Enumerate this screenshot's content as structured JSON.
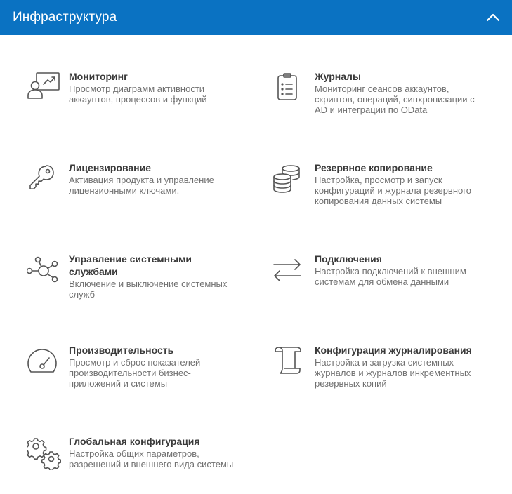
{
  "header": {
    "title": "Инфраструктура"
  },
  "tiles": [
    {
      "title": "Мониторинг",
      "description": "Просмотр диаграмм активности аккаунтов, процессов и функций",
      "icon": "monitoring-user-chart-icon"
    },
    {
      "title": "Журналы",
      "description": "Мониторинг сеансов аккаунтов, скриптов, операций, синхронизации с AD и интеграции по OData",
      "icon": "clipboard-list-icon"
    },
    {
      "title": "Лицензирование",
      "description": "Активация продукта и управление лицензионными ключами.",
      "icon": "key-icon"
    },
    {
      "title": "Резервное копирование",
      "description": "Настройка, просмотр и запуск конфигураций и журнала резервного копирования данных системы",
      "icon": "database-stack-icon"
    },
    {
      "title": "Управление системными службами",
      "description": "Включение и выключение системных служб",
      "icon": "network-hub-icon"
    },
    {
      "title": "Подключения",
      "description": "Настройка подключений к внешним системам для обмена данными",
      "icon": "arrows-exchange-icon"
    },
    {
      "title": "Производительность",
      "description": "Просмотр и сброс показателей производительности бизнес-приложений и системы",
      "icon": "gauge-icon"
    },
    {
      "title": "Конфигурация журналирования",
      "description": "Настройка и загрузка системных журналов и журналов инкрементных резервных копий",
      "icon": "scroll-icon"
    },
    {
      "title": "Глобальная конфигурация",
      "description": "Настройка общих параметров, разрешений и внешнего вида системы",
      "icon": "gears-icon"
    }
  ],
  "colors": {
    "header_bg": "#0a72c2",
    "header_text": "#ffffff",
    "title_text": "#3a3a3a",
    "desc_text": "#707070",
    "icon_stroke": "#555555"
  }
}
